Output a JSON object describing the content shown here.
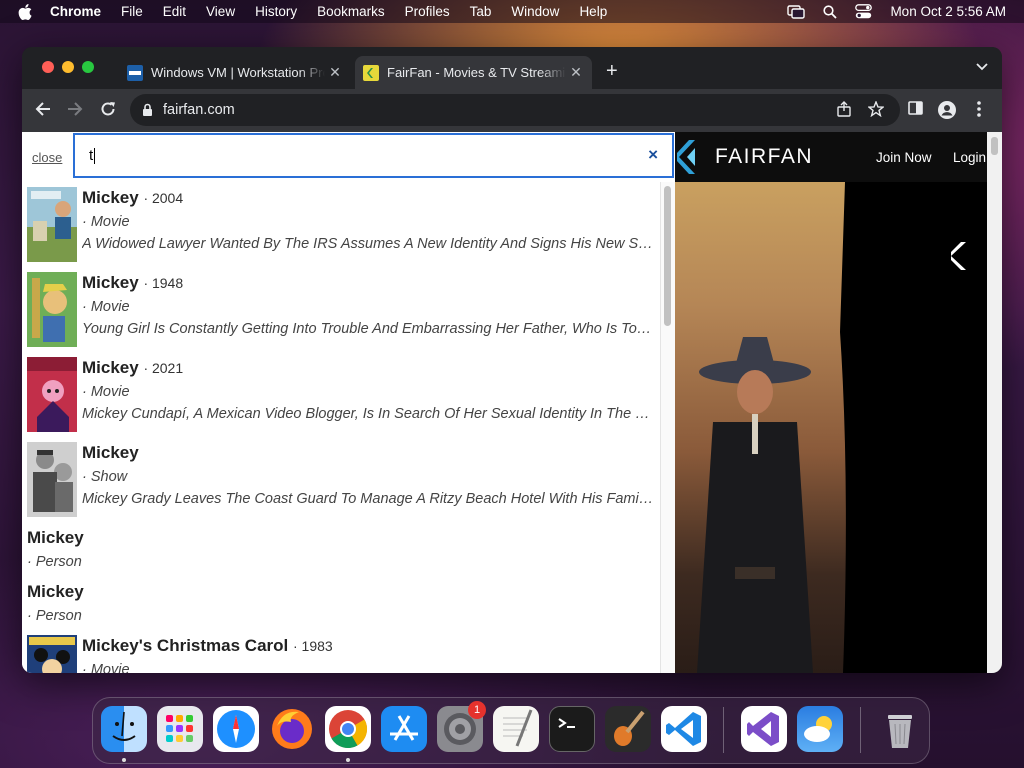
{
  "menubar": {
    "app_name": "Chrome",
    "items": [
      "File",
      "Edit",
      "View",
      "History",
      "Bookmarks",
      "Profiles",
      "Tab",
      "Window",
      "Help"
    ],
    "clock": "Mon Oct 2  5:56 AM"
  },
  "browser": {
    "tabs": [
      {
        "title": "Windows VM | Workstation Pro",
        "active": false,
        "icon": "vmware-icon"
      },
      {
        "title": "FairFan - Movies & TV Streaming",
        "active": true,
        "icon": "fairfan-icon"
      }
    ],
    "url": "fairfan.com"
  },
  "search": {
    "close_label": "close",
    "query": "t",
    "clear_label": "×",
    "results": [
      {
        "title": "Mickey",
        "year": "· 2004",
        "type": "· Movie",
        "description": "A Widowed Lawyer Wanted By The IRS Assumes A New Identity And Signs His New Son Up For Little League...",
        "has_image": true
      },
      {
        "title": "Mickey",
        "year": "· 1948",
        "type": "· Movie",
        "description": "Young Girl Is Constantly Getting Into Trouble And Embarrassing Her Father, Who Is Too Busy To Notice...",
        "has_image": true
      },
      {
        "title": "Mickey",
        "year": "· 2021",
        "type": "· Movie",
        "description": "Mickey Cundapí, A Mexican Video Blogger, Is In Search Of Her Sexual Identity In The City...",
        "has_image": true
      },
      {
        "title": "Mickey",
        "year": "",
        "type": "· Show",
        "description": "Mickey Grady Leaves The Coast Guard To Manage A Ritzy Beach Hotel With His Family...",
        "has_image": true
      },
      {
        "title": "Mickey",
        "year": "",
        "type": "· Person",
        "description": "",
        "has_image": false
      },
      {
        "title": "Mickey",
        "year": "",
        "type": "· Person",
        "description": "",
        "has_image": false
      },
      {
        "title": "Mickey's Christmas Carol",
        "year": "· 1983",
        "type": "· Movie",
        "description": "",
        "has_image": true
      }
    ]
  },
  "site": {
    "brand": "FAIRFAN",
    "join_label": "Join Now",
    "login_label": "Login"
  },
  "dock": {
    "apps": [
      "finder-icon",
      "launchpad-icon",
      "safari-icon",
      "firefox-icon",
      "chrome-icon",
      "app-store-icon",
      "system-settings-icon",
      "textedit-icon",
      "terminal-icon",
      "garageband-icon",
      "vscode-icon",
      "visual-studio-icon",
      "weather-icon",
      "trash-icon"
    ],
    "settings_badge": "1"
  }
}
